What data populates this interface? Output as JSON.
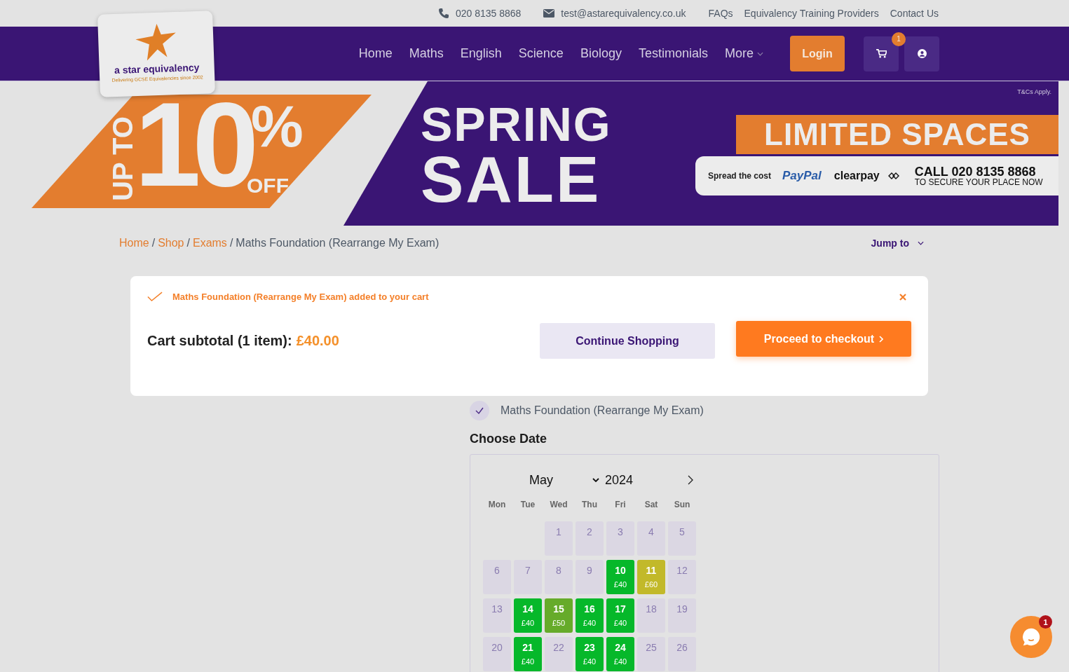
{
  "topbar": {
    "phone": "020 8135 8868",
    "email": "test@astarequivalency.co.uk",
    "links": [
      "FAQs",
      "Equivalency Training Providers",
      "Contact Us"
    ]
  },
  "logo": {
    "name": "a star equivalency",
    "tagline": "Delivering GCSE Equivalencies since 2002"
  },
  "nav": {
    "items": [
      {
        "label": "Home",
        "dropdown": false
      },
      {
        "label": "Maths",
        "dropdown": false
      },
      {
        "label": "English",
        "dropdown": false
      },
      {
        "label": "Science",
        "dropdown": false
      },
      {
        "label": "Biology",
        "dropdown": false
      },
      {
        "label": "Testimonials",
        "dropdown": false
      },
      {
        "label": "More",
        "dropdown": true
      }
    ],
    "login": "Login",
    "cart_count": "1"
  },
  "banner": {
    "up_to": "UP TO",
    "ten": "10",
    "percent": "%",
    "off": "OFF",
    "spring": "SPRING",
    "sale": "SALE",
    "terms": "T&Cs Apply.",
    "limited": "LIMITED SPACES",
    "spread": "Spread the cost",
    "paypal": "PayPal",
    "clearpay": "clearpay",
    "call": "CALL 020 8135 8868",
    "secure": "TO SECURE YOUR PLACE NOW"
  },
  "breadcrumb": {
    "links": [
      "Home",
      "Shop",
      "Exams"
    ],
    "separator": "/",
    "current": "Maths Foundation (Rearrange My Exam)",
    "jump_to": "Jump to"
  },
  "cart_notice": {
    "message": "Maths Foundation (Rearrange My Exam) added to your cart",
    "subtotal_label": "Cart subtotal (1 item):",
    "subtotal": "£40.00",
    "continue": "Continue Shopping",
    "checkout": "Proceed to checkout"
  },
  "product": {
    "name": "Maths Foundation (Rearrange My Exam)"
  },
  "calendar": {
    "title": "Choose Date",
    "month": "May",
    "year": "2024",
    "weekdays": [
      "Mon",
      "Tue",
      "Wed",
      "Thu",
      "Fri",
      "Sat",
      "Sun"
    ],
    "days": [
      {
        "kind": "blank"
      },
      {
        "kind": "blank"
      },
      {
        "kind": "unavailable",
        "day": "1"
      },
      {
        "kind": "unavailable",
        "day": "2"
      },
      {
        "kind": "unavailable",
        "day": "3"
      },
      {
        "kind": "unavailable",
        "day": "4"
      },
      {
        "kind": "unavailable",
        "day": "5"
      },
      {
        "kind": "unavailable",
        "day": "6"
      },
      {
        "kind": "unavailable",
        "day": "7"
      },
      {
        "kind": "unavailable",
        "day": "8"
      },
      {
        "kind": "unavailable",
        "day": "9"
      },
      {
        "kind": "available",
        "day": "10",
        "price": "£40",
        "color": "#06b82a"
      },
      {
        "kind": "available",
        "day": "11",
        "price": "£60",
        "color": "#c2b92a"
      },
      {
        "kind": "unavailable",
        "day": "12"
      },
      {
        "kind": "unavailable",
        "day": "13"
      },
      {
        "kind": "available",
        "day": "14",
        "price": "£40",
        "color": "#06b82a"
      },
      {
        "kind": "available",
        "day": "15",
        "price": "£50",
        "color": "#66ab2a"
      },
      {
        "kind": "available",
        "day": "16",
        "price": "£40",
        "color": "#06b82a"
      },
      {
        "kind": "available",
        "day": "17",
        "price": "£40",
        "color": "#06b82a"
      },
      {
        "kind": "unavailable",
        "day": "18"
      },
      {
        "kind": "unavailable",
        "day": "19"
      },
      {
        "kind": "unavailable",
        "day": "20"
      },
      {
        "kind": "available",
        "day": "21",
        "price": "£40",
        "color": "#06b82a"
      },
      {
        "kind": "unavailable",
        "day": "22"
      },
      {
        "kind": "available",
        "day": "23",
        "price": "£40",
        "color": "#06b82a"
      },
      {
        "kind": "available",
        "day": "24",
        "price": "£40",
        "color": "#06b82a"
      },
      {
        "kind": "unavailable",
        "day": "25"
      },
      {
        "kind": "unavailable",
        "day": "26"
      }
    ]
  },
  "chat": {
    "badge": "1"
  }
}
